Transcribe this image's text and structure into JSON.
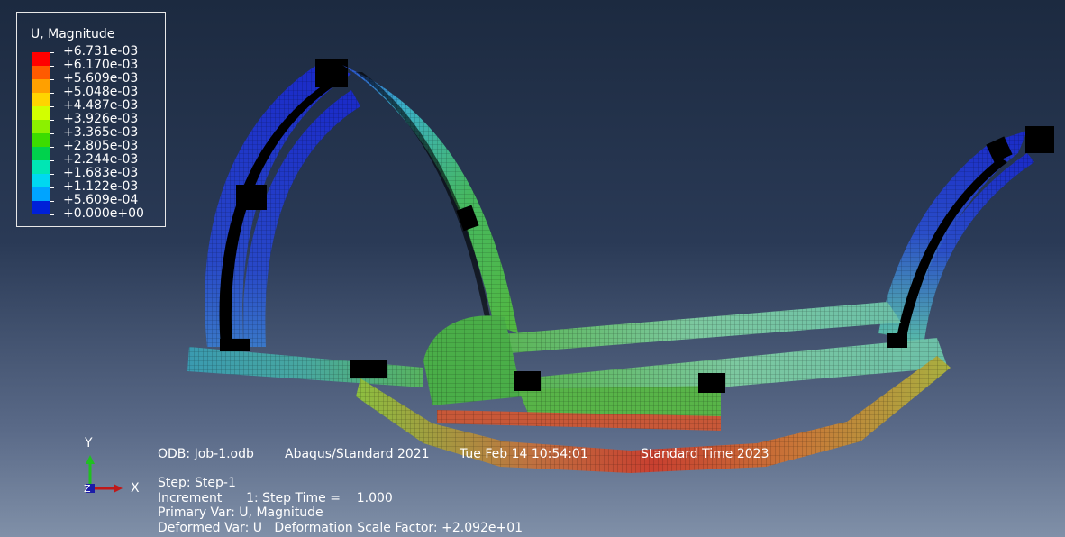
{
  "legend": {
    "title": "U, Magnitude",
    "levels": [
      {
        "label": "+6.731e-03",
        "color": "#ff0000"
      },
      {
        "label": "+6.170e-03",
        "color": "#ff5a00"
      },
      {
        "label": "+5.609e-03",
        "color": "#ffa000"
      },
      {
        "label": "+5.048e-03",
        "color": "#ffd400"
      },
      {
        "label": "+4.487e-03",
        "color": "#d2ff00"
      },
      {
        "label": "+3.926e-03",
        "color": "#8cf000"
      },
      {
        "label": "+3.365e-03",
        "color": "#3cdc00"
      },
      {
        "label": "+2.805e-03",
        "color": "#00d24c"
      },
      {
        "label": "+2.244e-03",
        "color": "#00e6b4"
      },
      {
        "label": "+1.683e-03",
        "color": "#00d8f0"
      },
      {
        "label": "+1.122e-03",
        "color": "#00a4ff"
      },
      {
        "label": "+5.609e-04",
        "color": "#0060ff"
      },
      {
        "label": "+0.000e+00",
        "color": "#0020d8"
      }
    ]
  },
  "info": {
    "odb": "ODB: Job-1.odb",
    "solver": "Abaqus/Standard 2021",
    "datetime": "Tue Feb 14 10:54:01",
    "timezone": "Standard Time 2023",
    "step": "Step: Step-1",
    "increment": "Increment      1: Step Time =    1.000",
    "primary_var": "Primary Var: U, Magnitude",
    "deformed_var": "Deformed Var: U   Deformation Scale Factor: +2.092e+01"
  },
  "triad": {
    "y": "Y",
    "x": "X",
    "z": "Z"
  },
  "colors": {
    "mesh_line": "#0a0a0a",
    "highlight": "#101010"
  }
}
